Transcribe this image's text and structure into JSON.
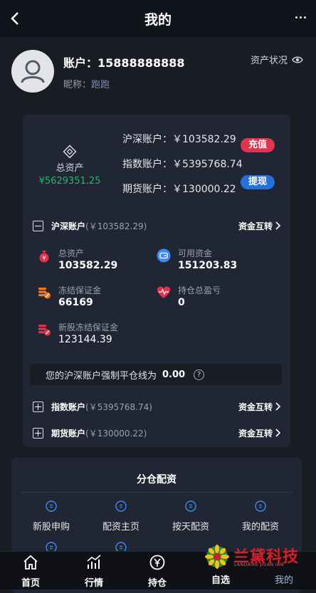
{
  "header": {
    "title": "我的"
  },
  "profile": {
    "account_label": "账户：",
    "account_value": "15888888888",
    "nick_label": "昵称：",
    "nick_value": "跑跑",
    "asset_status": "资产状况"
  },
  "summary": {
    "total_label": "总资产",
    "total_value": "¥5629351.25",
    "lines": [
      {
        "label": "沪深账户：",
        "value": "￥103582.29"
      },
      {
        "label": "指数账户：",
        "value": "￥5395768.74"
      },
      {
        "label": "期货账户：",
        "value": "￥130000.22"
      }
    ],
    "recharge": "充值",
    "withdraw": "提现"
  },
  "accounts": [
    {
      "name": "沪深账户",
      "sub": "(￥103582.29)",
      "transfer": "资金互转"
    },
    {
      "name": "指数账户",
      "sub": "(￥5395768.74)",
      "transfer": "资金互转"
    },
    {
      "name": "期货账户",
      "sub": "(￥130000.22)",
      "transfer": "资金互转"
    }
  ],
  "stats": [
    {
      "label": "总资产",
      "value": "103582.29"
    },
    {
      "label": "可用资金",
      "value": "151203.83"
    },
    {
      "label": "冻结保证金",
      "value": "66169"
    },
    {
      "label": "持仓总盈亏",
      "value": "0"
    },
    {
      "label": "新股冻结保证金",
      "value": "123144.39"
    }
  ],
  "forced_line": {
    "text": "您的沪深账户强制平仓线为",
    "value": "0.00"
  },
  "allocation": {
    "title": "分仓配资",
    "items": [
      "新股申购",
      "配资主页",
      "按天配资",
      "我的配资"
    ]
  },
  "tabs": [
    "首页",
    "行情",
    "持仓",
    "自选",
    "我的"
  ],
  "brand": {
    "cn": "兰黛科技",
    "en": "LANDAIKE JIUAN IAN"
  },
  "colors": {
    "accent_red": "#e0334e",
    "accent_blue": "#2570d9",
    "total_green": "#2fb36a"
  }
}
